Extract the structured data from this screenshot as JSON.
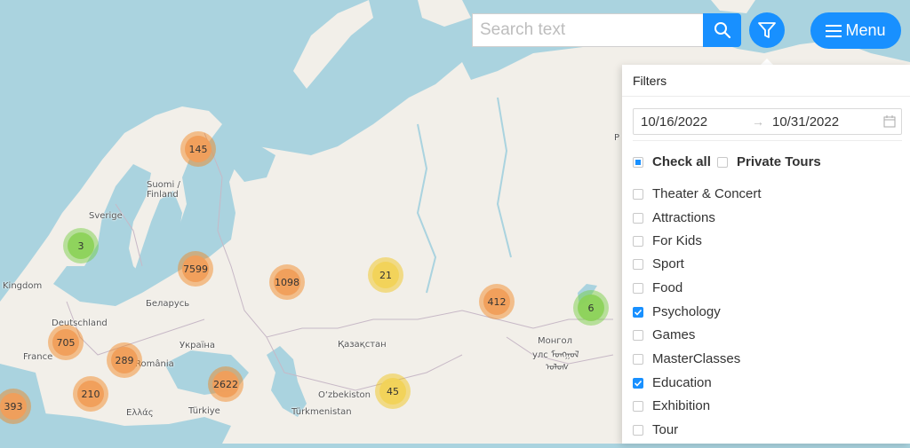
{
  "map": {
    "labels": [
      {
        "text": "Suomi /",
        "name": "label-suomi"
      },
      {
        "text": "Finland",
        "name": "label-finland"
      },
      {
        "text": "Sverige",
        "name": "label-sverige"
      },
      {
        "text": "Kingdom",
        "name": "label-kingdom"
      },
      {
        "text": "Deutschland",
        "name": "label-deutschland"
      },
      {
        "text": "France",
        "name": "label-france"
      },
      {
        "text": "Беларусь",
        "name": "label-belarus"
      },
      {
        "text": "Україна",
        "name": "label-ukraine"
      },
      {
        "text": "România",
        "name": "label-romania"
      },
      {
        "text": "Ελλάς",
        "name": "label-hellas"
      },
      {
        "text": "Türkiye",
        "name": "label-turkiye"
      },
      {
        "text": "Қазақстан",
        "name": "label-kazakhstan"
      },
      {
        "text": "O‘zbekiston",
        "name": "label-uzbekistan"
      },
      {
        "text": "Türkmenistan",
        "name": "label-turkmenistan"
      },
      {
        "text": "Монгол",
        "name": "label-mongol"
      },
      {
        "text": "улс ᠮᠣᠩᠭᠣᠯ",
        "name": "label-mongol-uls"
      },
      {
        "text": "ᠤᠯᠤᠰ",
        "name": "label-mongol-script"
      },
      {
        "text": "P",
        "name": "label-edge-p"
      }
    ],
    "clusters": [
      {
        "count": "145",
        "color": "orange"
      },
      {
        "count": "3",
        "color": "green"
      },
      {
        "count": "7599",
        "color": "orange"
      },
      {
        "count": "1098",
        "color": "orange"
      },
      {
        "count": "21",
        "color": "yellow"
      },
      {
        "count": "412",
        "color": "orange"
      },
      {
        "count": "6",
        "color": "green"
      },
      {
        "count": "705",
        "color": "orange"
      },
      {
        "count": "289",
        "color": "orange"
      },
      {
        "count": "2622",
        "color": "orange"
      },
      {
        "count": "210",
        "color": "orange"
      },
      {
        "count": "393",
        "color": "orange"
      },
      {
        "count": "45",
        "color": "yellow"
      }
    ]
  },
  "search": {
    "placeholder": "Search text",
    "value": ""
  },
  "menu": {
    "label": "Menu"
  },
  "colors": {
    "accent": "#1890ff",
    "cluster_orange": "#f09e5a",
    "cluster_yellow": "#f1d357",
    "cluster_green": "#8cd25a"
  },
  "filters": {
    "title": "Filters",
    "date_start": "10/16/2022",
    "date_end": "10/31/2022",
    "arrow": "→",
    "check_all": {
      "label": "Check all",
      "state": "indeterminate"
    },
    "private_tours": {
      "label": "Private Tours",
      "checked": false
    },
    "categories": [
      {
        "label": "Theater & Concert",
        "checked": false
      },
      {
        "label": "Attractions",
        "checked": false
      },
      {
        "label": "For Kids",
        "checked": false
      },
      {
        "label": "Sport",
        "checked": false
      },
      {
        "label": "Food",
        "checked": false
      },
      {
        "label": "Psychology",
        "checked": true
      },
      {
        "label": "Games",
        "checked": false
      },
      {
        "label": "MasterClasses",
        "checked": false
      },
      {
        "label": "Education",
        "checked": true
      },
      {
        "label": "Exhibition",
        "checked": false
      },
      {
        "label": "Tour",
        "checked": false
      }
    ]
  }
}
